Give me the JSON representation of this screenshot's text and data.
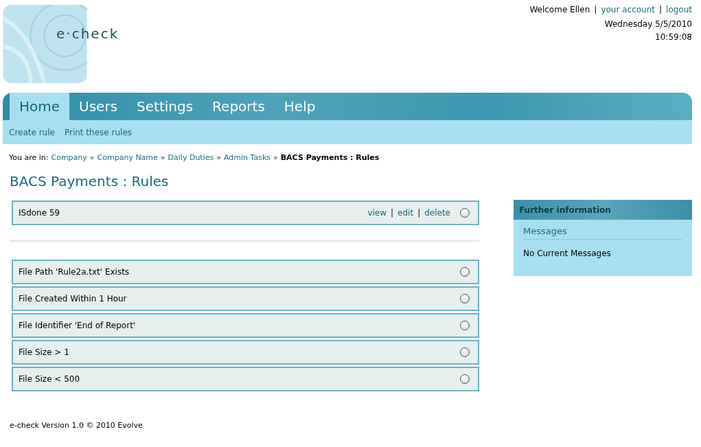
{
  "logo": {
    "text": "e·check"
  },
  "user_bar": {
    "welcome": "Welcome Ellen",
    "links": [
      "your account",
      "logout"
    ],
    "separator": "|"
  },
  "date": "Wednesday 5/5/2010",
  "time": "10:59:08",
  "tabs": [
    {
      "label": "Home",
      "selected": true
    },
    {
      "label": "Users",
      "selected": false
    },
    {
      "label": "Settings",
      "selected": false
    },
    {
      "label": "Reports",
      "selected": false
    },
    {
      "label": "Help",
      "selected": false
    }
  ],
  "sub_nav": [
    "Create rule",
    "Print these rules"
  ],
  "breadcrumb": {
    "prefix": "You are in:",
    "links": [
      "Company",
      "Company Name",
      "Daily Duties",
      "Admin Tasks"
    ],
    "separator": "»",
    "current": "BACS Payments : Rules"
  },
  "title": "BACS Payments : Rules",
  "header_rule": {
    "name": "ISdone 59",
    "actions": [
      "view",
      "edit",
      "delete"
    ],
    "separator": "|",
    "selected": false
  },
  "rules": [
    {
      "name": "File Path 'Rule2a.txt' Exists",
      "selected": false
    },
    {
      "name": "File Created Within 1 Hour",
      "selected": false
    },
    {
      "name": "File Identifier 'End of Report'",
      "selected": false
    },
    {
      "name": "File Size > 1",
      "selected": false
    },
    {
      "name": "File Size < 500",
      "selected": false
    }
  ],
  "sidebar": {
    "title": "Further information",
    "section": "Messages",
    "text": "No Current Messages"
  },
  "footer": "e-check Version 1.0 © 2010 Evolve"
}
